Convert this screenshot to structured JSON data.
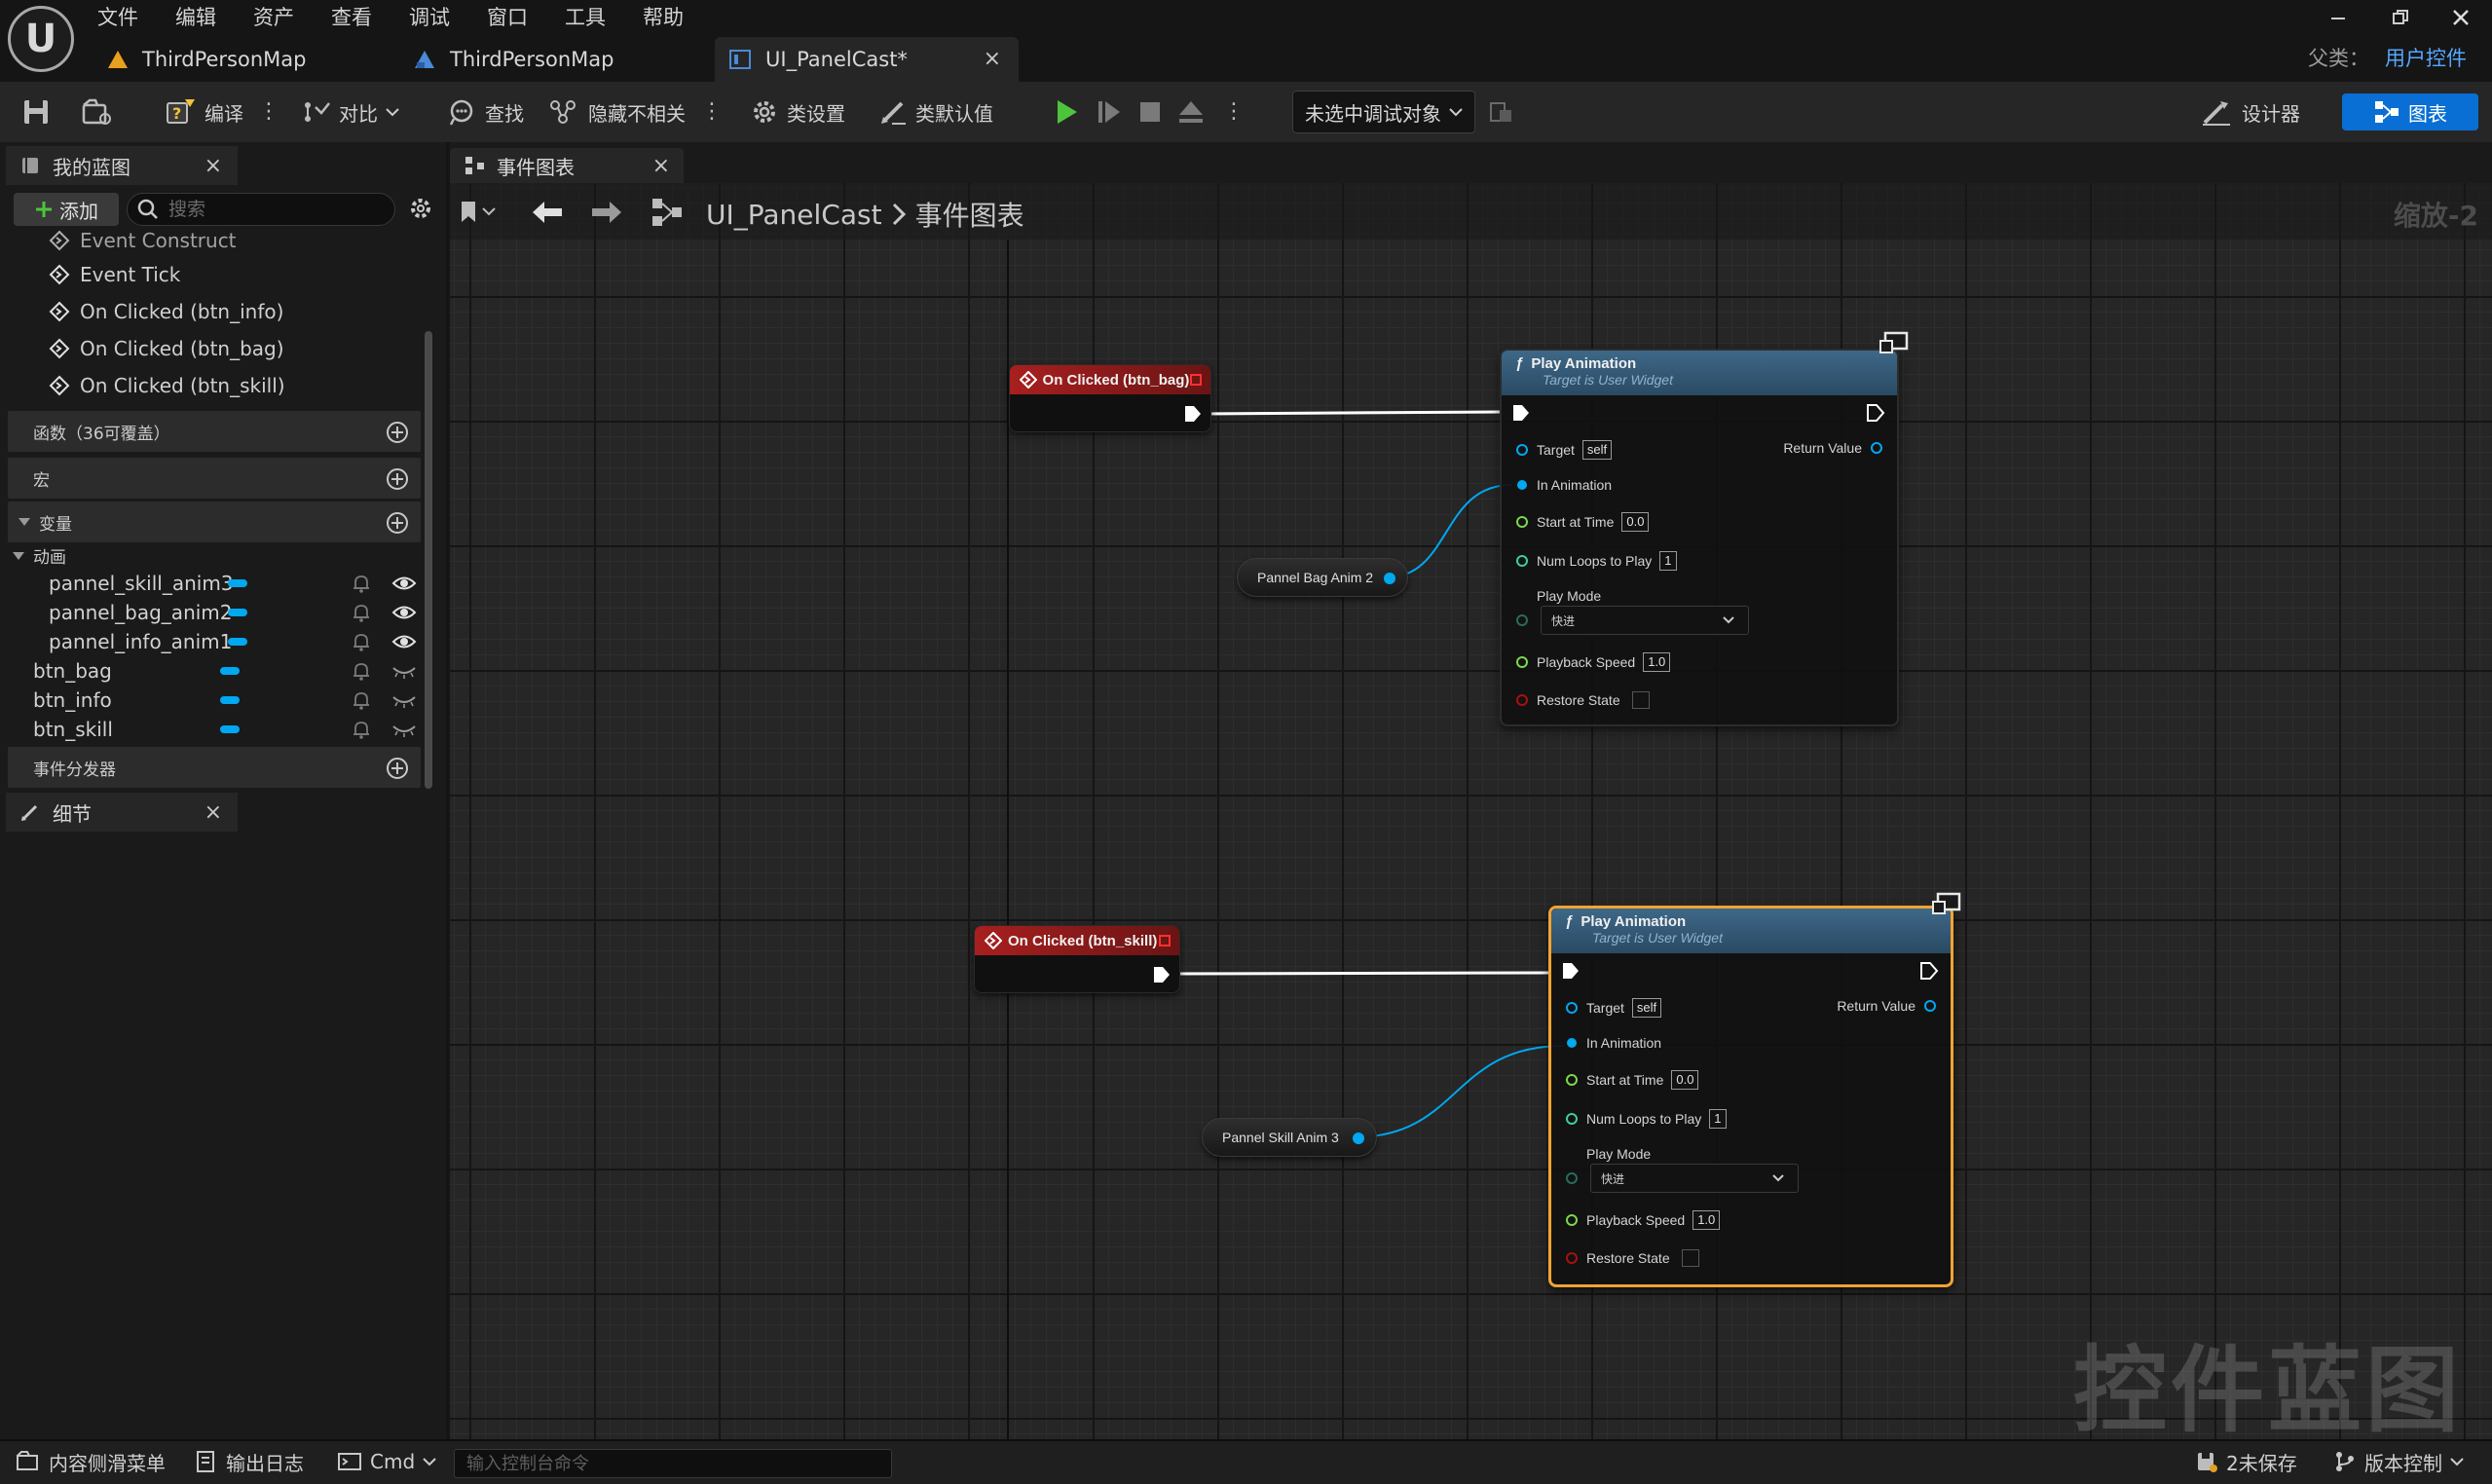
{
  "menu": [
    "文件",
    "编辑",
    "资产",
    "查看",
    "调试",
    "窗口",
    "工具",
    "帮助"
  ],
  "tabs": [
    {
      "label": "ThirdPersonMap",
      "icon": "level-icon"
    },
    {
      "label": "ThirdPersonMap",
      "icon": "blueprint-icon"
    },
    {
      "label": "UI_PanelCast*",
      "icon": "widget-blueprint-icon",
      "active": true
    }
  ],
  "parent_class": {
    "label": "父类：",
    "value": "用户控件"
  },
  "toolbar": {
    "compile": "编译",
    "diff": "对比",
    "find": "查找",
    "hide_unrelated": "隐藏不相关",
    "class_settings": "类设置",
    "class_defaults": "类默认值",
    "debug_object": "未选中调试对象",
    "designer": "设计器",
    "graph": "图表"
  },
  "my_blueprint": {
    "tab": "我的蓝图",
    "add": "添加",
    "search_placeholder": "搜索",
    "events": [
      "Event Construct",
      "Event Tick",
      "On Clicked (btn_info)",
      "On Clicked (btn_bag)",
      "On Clicked (btn_skill)"
    ],
    "sections": {
      "functions": "函数（36可覆盖）",
      "macros": "宏",
      "variables": "变量",
      "animations": "动画",
      "dispatchers": "事件分发器"
    },
    "animation_vars": [
      "pannel_skill_anim3",
      "pannel_bag_anim2",
      "pannel_info_anim1"
    ],
    "widget_vars": [
      "btn_bag",
      "btn_info",
      "btn_skill"
    ]
  },
  "details": {
    "tab": "细节"
  },
  "graph": {
    "tab": "事件图表",
    "breadcrumb_root": "UI_PanelCast",
    "breadcrumb_leaf": "事件图表",
    "zoom": "缩放-2",
    "watermark": "控件蓝图",
    "nodes": {
      "evt1": {
        "title": "On Clicked (btn_bag)"
      },
      "evt2": {
        "title": "On Clicked (btn_skill)"
      },
      "var1": {
        "label": "Pannel Bag Anim 2"
      },
      "var2": {
        "label": "Pannel Skill Anim 3"
      },
      "fn": {
        "title": "Play Animation",
        "subtitle": "Target is User Widget",
        "target": "Target",
        "target_val": "self",
        "return_value": "Return Value",
        "in_animation": "In Animation",
        "start_at_time": "Start at Time",
        "start_at_time_val": "0.0",
        "num_loops": "Num Loops to Play",
        "num_loops_val": "1",
        "play_mode": "Play Mode",
        "play_mode_val": "快进",
        "playback_speed": "Playback Speed",
        "playback_speed_val": "1.0",
        "restore_state": "Restore State"
      }
    }
  },
  "bottom": {
    "content_drawer": "内容侧滑菜单",
    "output_log": "输出日志",
    "cmd": "Cmd",
    "cmd_placeholder": "输入控制台命令",
    "unsaved": "2未保存",
    "source_control": "版本控制"
  },
  "colors": {
    "accent": "#0a6fd4",
    "event_header": "#a81f1f",
    "function_header": "#3e6888",
    "selected": "#f3a332",
    "object_pin": "#00a8f0",
    "exec_pin": "#ffffff"
  }
}
